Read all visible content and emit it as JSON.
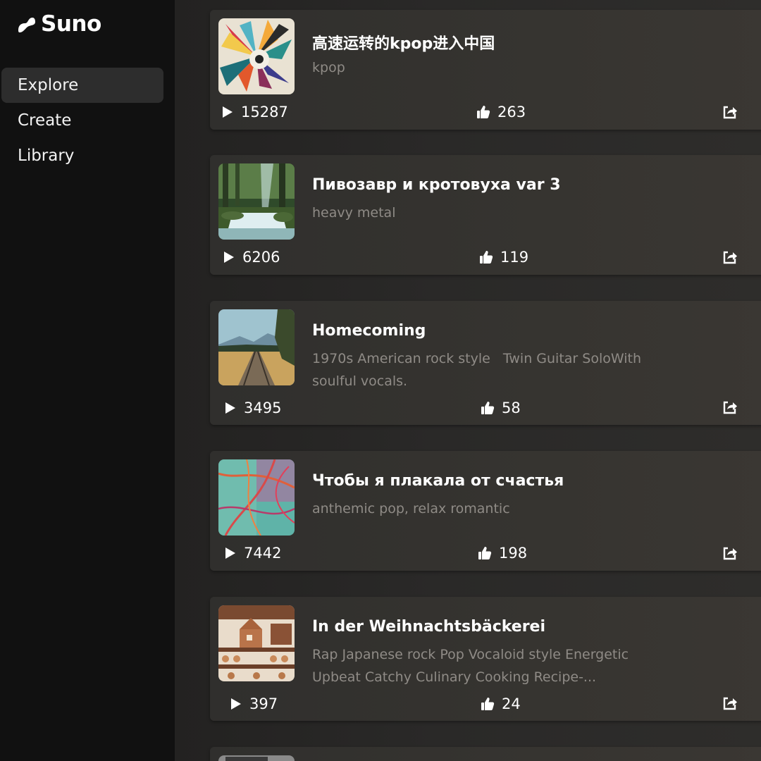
{
  "app": {
    "name": "Suno"
  },
  "sidebar": {
    "items": [
      {
        "label": "Explore"
      },
      {
        "label": "Create"
      },
      {
        "label": "Library"
      }
    ]
  },
  "songs": [
    {
      "title": "高速运转的kpop进入中国",
      "style": "kpop",
      "plays": "15287",
      "likes": "263"
    },
    {
      "title": "Пивозавр и кротовуха var 3",
      "style": "heavy metal",
      "plays": "6206",
      "likes": "119"
    },
    {
      "title": "Homecoming",
      "style": "1970s American rock style   Twin Guitar SoloWith soulful vocals.",
      "plays": "3495",
      "likes": "58"
    },
    {
      "title": "Чтобы я плакала от счастья",
      "style": "anthemic pop, relax romantic",
      "plays": "7442",
      "likes": "198"
    },
    {
      "title": "In der Weihnachtsbäckerei",
      "style": "Rap Japanese rock Pop Vocaloid style Energetic Upbeat Catchy Culinary Cooking Recipe-...",
      "plays": "397",
      "likes": "24"
    }
  ],
  "icons": {
    "play": "play-icon",
    "like": "thumbs-up-icon",
    "share": "share-icon"
  },
  "colors": {
    "sidebar_bg": "#111111",
    "active_nav": "#2d2d2d",
    "card_bg": "#363430",
    "muted_text": "#8f8b86"
  }
}
